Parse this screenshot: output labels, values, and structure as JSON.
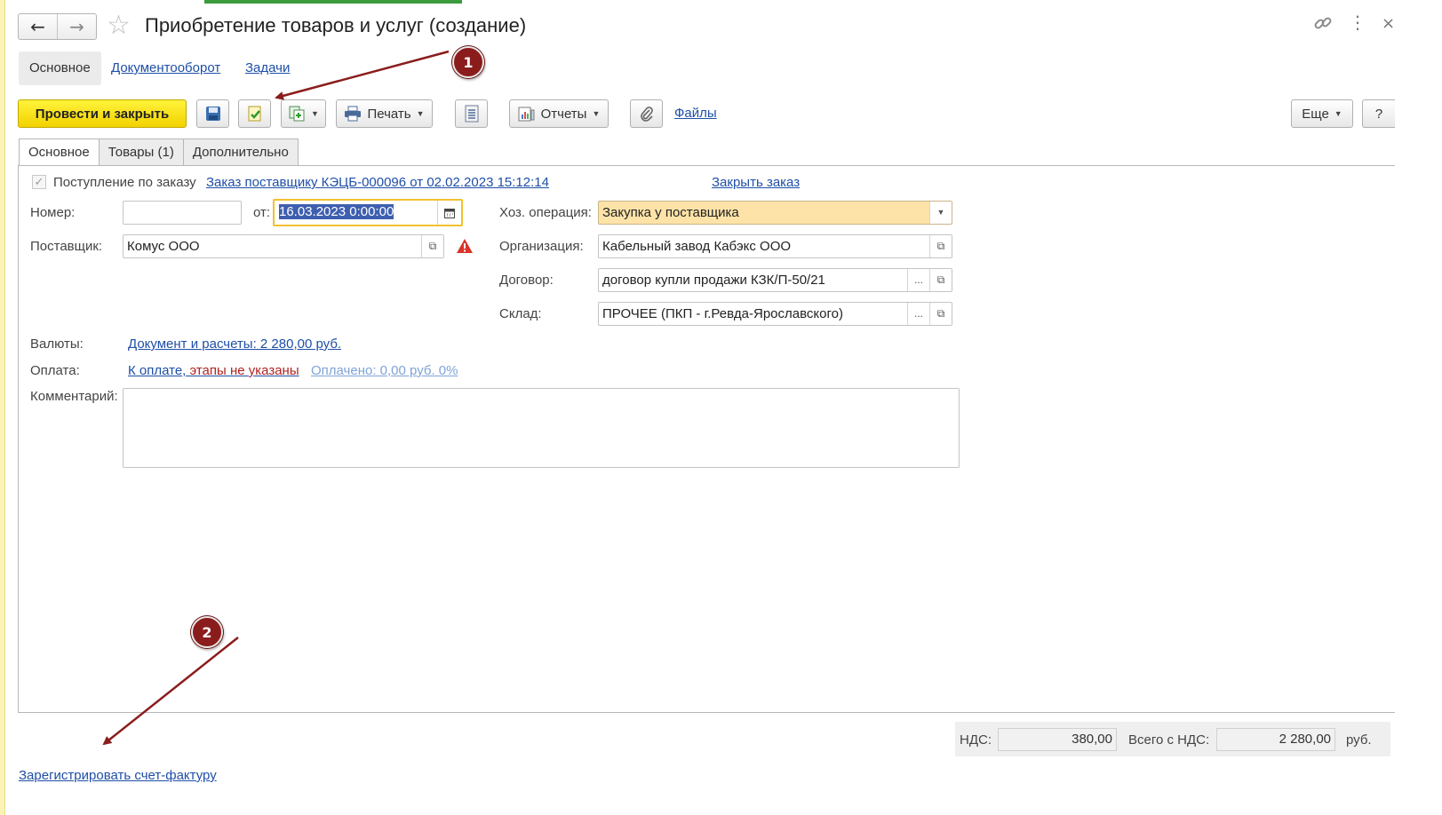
{
  "window": {
    "title": "Приобретение товаров и услуг (создание)",
    "close_glyph": "×"
  },
  "sections": {
    "main": "Основное",
    "docflow": "Документооборот",
    "tasks": "Задачи"
  },
  "toolbar": {
    "post_and_close": "Провести и закрыть",
    "print": "Печать",
    "reports": "Отчеты",
    "files": "Файлы",
    "more": "Еще",
    "help": "?"
  },
  "tabs": [
    "Основное",
    "Товары (1)",
    "Дополнительно"
  ],
  "form": {
    "by_order_label": "Поступление по заказу",
    "order_link": "Заказ поставщику КЭЦБ-000096 от 02.02.2023 15:12:14",
    "close_order": "Закрыть заказ",
    "number_label": "Номер:",
    "number_value": "",
    "date_label": "от:",
    "date_value": "16.03.2023  0:00:00",
    "supplier_label": "Поставщик:",
    "supplier_value": "Комус ООО",
    "operation_label": "Хоз. операция:",
    "operation_value": "Закупка у поставщика",
    "org_label": "Организация:",
    "org_value": "Кабельный завод Кабэкс ООО",
    "contract_label": "Договор:",
    "contract_value": "договор купли продажи КЗК/П-50/21",
    "warehouse_label": "Склад:",
    "warehouse_value": "ПРОЧЕЕ (ПКП - г.Ревда-Ярославского)",
    "currency_label": "Валюты:",
    "currency_link": "Документ и расчеты: 2 280,00 руб.",
    "payment_label": "Оплата:",
    "payment_link_a": "К оплате, ",
    "payment_link_b": "этапы не указаны",
    "paid_link": "Оплачено: 0,00 руб. 0%",
    "comment_label": "Комментарий:",
    "comment_value": "",
    "ellipsis": "..."
  },
  "footer": {
    "vat_label": "НДС:",
    "vat_value": "380,00",
    "total_label": "Всего с НДС:",
    "total_value": "2 280,00",
    "currency": "руб.",
    "register_invoice": "Зарегистрировать счет-фактуру"
  },
  "annotations": {
    "badge_1": "1",
    "badge_2": "2",
    "arrow_color": "#8b1c1c"
  },
  "colors": {
    "primary_button": "#f5dc00",
    "link": "#1f4fa7",
    "highlight_field": "#fde3a8",
    "warning": "#d9352a"
  }
}
